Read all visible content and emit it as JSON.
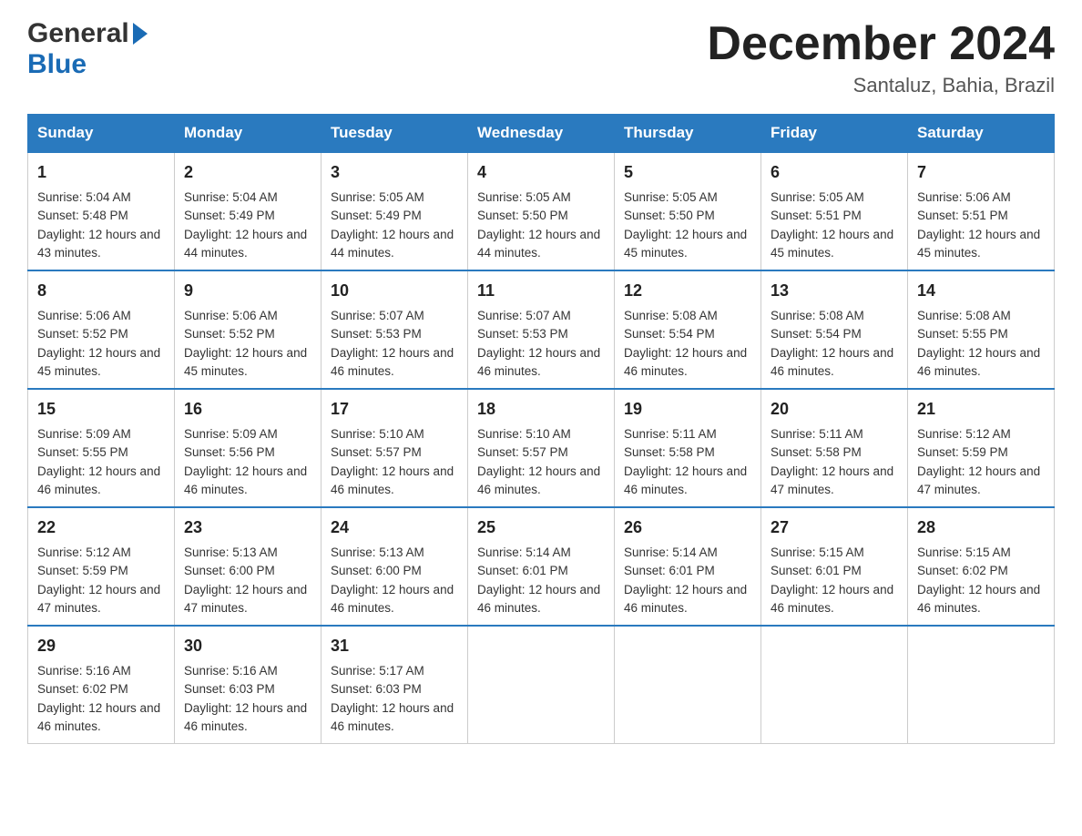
{
  "header": {
    "logo_general": "General",
    "logo_blue": "Blue",
    "month_title": "December 2024",
    "subtitle": "Santaluz, Bahia, Brazil"
  },
  "days_of_week": [
    "Sunday",
    "Monday",
    "Tuesday",
    "Wednesday",
    "Thursday",
    "Friday",
    "Saturday"
  ],
  "weeks": [
    [
      {
        "day": "1",
        "sunrise": "5:04 AM",
        "sunset": "5:48 PM",
        "daylight": "12 hours and 43 minutes."
      },
      {
        "day": "2",
        "sunrise": "5:04 AM",
        "sunset": "5:49 PM",
        "daylight": "12 hours and 44 minutes."
      },
      {
        "day": "3",
        "sunrise": "5:05 AM",
        "sunset": "5:49 PM",
        "daylight": "12 hours and 44 minutes."
      },
      {
        "day": "4",
        "sunrise": "5:05 AM",
        "sunset": "5:50 PM",
        "daylight": "12 hours and 44 minutes."
      },
      {
        "day": "5",
        "sunrise": "5:05 AM",
        "sunset": "5:50 PM",
        "daylight": "12 hours and 45 minutes."
      },
      {
        "day": "6",
        "sunrise": "5:05 AM",
        "sunset": "5:51 PM",
        "daylight": "12 hours and 45 minutes."
      },
      {
        "day": "7",
        "sunrise": "5:06 AM",
        "sunset": "5:51 PM",
        "daylight": "12 hours and 45 minutes."
      }
    ],
    [
      {
        "day": "8",
        "sunrise": "5:06 AM",
        "sunset": "5:52 PM",
        "daylight": "12 hours and 45 minutes."
      },
      {
        "day": "9",
        "sunrise": "5:06 AM",
        "sunset": "5:52 PM",
        "daylight": "12 hours and 45 minutes."
      },
      {
        "day": "10",
        "sunrise": "5:07 AM",
        "sunset": "5:53 PM",
        "daylight": "12 hours and 46 minutes."
      },
      {
        "day": "11",
        "sunrise": "5:07 AM",
        "sunset": "5:53 PM",
        "daylight": "12 hours and 46 minutes."
      },
      {
        "day": "12",
        "sunrise": "5:08 AM",
        "sunset": "5:54 PM",
        "daylight": "12 hours and 46 minutes."
      },
      {
        "day": "13",
        "sunrise": "5:08 AM",
        "sunset": "5:54 PM",
        "daylight": "12 hours and 46 minutes."
      },
      {
        "day": "14",
        "sunrise": "5:08 AM",
        "sunset": "5:55 PM",
        "daylight": "12 hours and 46 minutes."
      }
    ],
    [
      {
        "day": "15",
        "sunrise": "5:09 AM",
        "sunset": "5:55 PM",
        "daylight": "12 hours and 46 minutes."
      },
      {
        "day": "16",
        "sunrise": "5:09 AM",
        "sunset": "5:56 PM",
        "daylight": "12 hours and 46 minutes."
      },
      {
        "day": "17",
        "sunrise": "5:10 AM",
        "sunset": "5:57 PM",
        "daylight": "12 hours and 46 minutes."
      },
      {
        "day": "18",
        "sunrise": "5:10 AM",
        "sunset": "5:57 PM",
        "daylight": "12 hours and 46 minutes."
      },
      {
        "day": "19",
        "sunrise": "5:11 AM",
        "sunset": "5:58 PM",
        "daylight": "12 hours and 46 minutes."
      },
      {
        "day": "20",
        "sunrise": "5:11 AM",
        "sunset": "5:58 PM",
        "daylight": "12 hours and 47 minutes."
      },
      {
        "day": "21",
        "sunrise": "5:12 AM",
        "sunset": "5:59 PM",
        "daylight": "12 hours and 47 minutes."
      }
    ],
    [
      {
        "day": "22",
        "sunrise": "5:12 AM",
        "sunset": "5:59 PM",
        "daylight": "12 hours and 47 minutes."
      },
      {
        "day": "23",
        "sunrise": "5:13 AM",
        "sunset": "6:00 PM",
        "daylight": "12 hours and 47 minutes."
      },
      {
        "day": "24",
        "sunrise": "5:13 AM",
        "sunset": "6:00 PM",
        "daylight": "12 hours and 46 minutes."
      },
      {
        "day": "25",
        "sunrise": "5:14 AM",
        "sunset": "6:01 PM",
        "daylight": "12 hours and 46 minutes."
      },
      {
        "day": "26",
        "sunrise": "5:14 AM",
        "sunset": "6:01 PM",
        "daylight": "12 hours and 46 minutes."
      },
      {
        "day": "27",
        "sunrise": "5:15 AM",
        "sunset": "6:01 PM",
        "daylight": "12 hours and 46 minutes."
      },
      {
        "day": "28",
        "sunrise": "5:15 AM",
        "sunset": "6:02 PM",
        "daylight": "12 hours and 46 minutes."
      }
    ],
    [
      {
        "day": "29",
        "sunrise": "5:16 AM",
        "sunset": "6:02 PM",
        "daylight": "12 hours and 46 minutes."
      },
      {
        "day": "30",
        "sunrise": "5:16 AM",
        "sunset": "6:03 PM",
        "daylight": "12 hours and 46 minutes."
      },
      {
        "day": "31",
        "sunrise": "5:17 AM",
        "sunset": "6:03 PM",
        "daylight": "12 hours and 46 minutes."
      },
      null,
      null,
      null,
      null
    ]
  ],
  "labels": {
    "sunrise_prefix": "Sunrise: ",
    "sunset_prefix": "Sunset: ",
    "daylight_prefix": "Daylight: "
  }
}
